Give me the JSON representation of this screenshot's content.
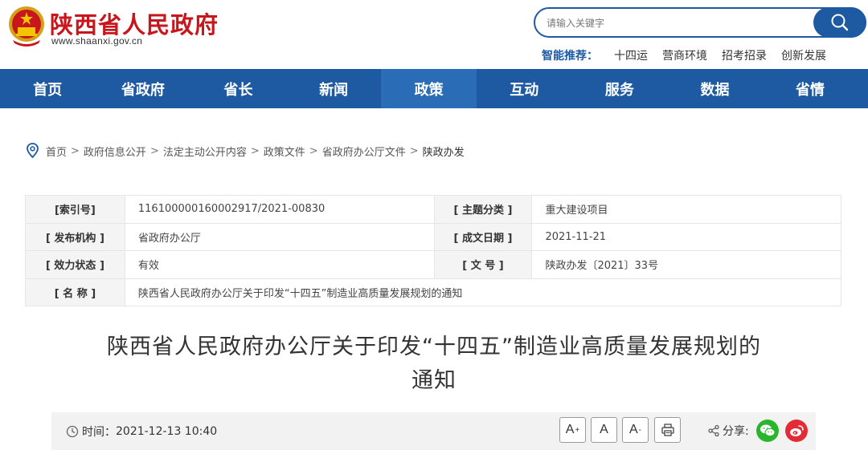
{
  "header": {
    "site_title": "陕西省人民政府",
    "site_url": "www.shaanxi.gov.cn",
    "search": {
      "placeholder": "请输入关键字"
    },
    "smart_label": "智能推荐：",
    "smart_links": [
      "十四运",
      "营商环境",
      "招考招录",
      "创新发展"
    ]
  },
  "nav": {
    "items": [
      "首页",
      "省政府",
      "省长",
      "新闻",
      "政策",
      "互动",
      "服务",
      "数据",
      "省情"
    ],
    "active": "政策"
  },
  "breadcrumb": [
    "首页",
    "政府信息公开",
    "法定主动公开内容",
    "政策文件",
    "省政府办公厅文件",
    "陕政办发"
  ],
  "breadcrumb_sep": ">",
  "info": {
    "index_label": "[索引号]",
    "index_value": "116100000160002917/2021-00830",
    "topic_label": "[ 主题分类 ]",
    "topic_value": "重大建设项目",
    "issuer_label": "[ 发布机构 ]",
    "issuer_value": "省政府办公厅",
    "date_label": "[ 成文日期 ]",
    "date_value": "2021-11-21",
    "status_label": "[ 效力状态 ]",
    "status_value": "有效",
    "docno_label": "[ 文 号 ]",
    "docno_value": "陕政办发〔2021〕33号",
    "name_label": "[ 名 称 ]",
    "name_value": "陕西省人民政府办公厅关于印发“十四五”制造业高质量发展规划的通知"
  },
  "article": {
    "title_line1": "陕西省人民政府办公厅关于印发“十四五”制造业高质量发展规划的",
    "title_line2": "通知"
  },
  "toolbar": {
    "time_label": "时间：",
    "time_value": "2021-12-13 10:40",
    "font_larger": "A",
    "font_larger_sup": "+",
    "font_normal": "A",
    "font_smaller": "A",
    "font_smaller_sup": "-",
    "share_label": "分享:"
  },
  "colors": {
    "brand_red": "#c8161d",
    "brand_blue": "#1d5aa2",
    "wechat": "#2ab52d",
    "weibo": "#e22b36"
  }
}
